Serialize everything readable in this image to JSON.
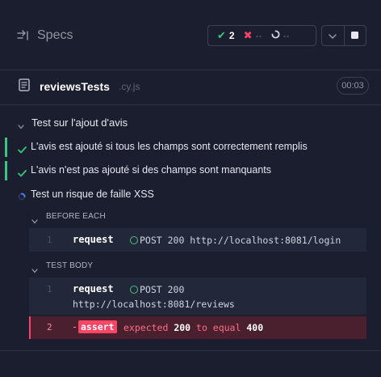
{
  "header": {
    "specs_label": "Specs",
    "stats": {
      "passed_glyph": "✔",
      "passed_count": "2",
      "failed_glyph": "✖",
      "failed_count": "--",
      "pending_count": "--"
    },
    "controls": {
      "chevron_icon": "chevron-down-icon",
      "stop_icon": "stop-icon"
    }
  },
  "spec": {
    "name": "reviewsTests",
    "ext": ".cy.js",
    "duration": "00:03"
  },
  "suite": {
    "title": "Test sur l'ajout d'avis",
    "tests": [
      {
        "label": "L'avis est ajouté si tous les champs sont correctement remplis",
        "status": "passed"
      },
      {
        "label": "L'avis n'est pas ajouté si des champs sont manquants",
        "status": "passed"
      },
      {
        "label": "Test un risque de faille XSS",
        "status": "running"
      }
    ]
  },
  "hooks": {
    "before_each": {
      "label": "BEFORE EACH",
      "commands": [
        {
          "num": "1",
          "name": "request",
          "text": "POST 200 http://localhost:8081/login"
        }
      ]
    },
    "test_body": {
      "label": "TEST BODY",
      "commands": [
        {
          "num": "1",
          "name": "request",
          "text_line1": "POST 200",
          "text_line2": "http://localhost:8081/reviews"
        }
      ],
      "failed_command": {
        "num": "2",
        "dash": "-",
        "name": "assert",
        "msg_prefix": "expected ",
        "expected": "200",
        "msg_mid": " to equal ",
        "actual": "400"
      }
    }
  },
  "colors": {
    "background": "#1b1e2e",
    "passed": "#3fc380",
    "failed": "#ff4566",
    "running": "#4e7dff"
  }
}
